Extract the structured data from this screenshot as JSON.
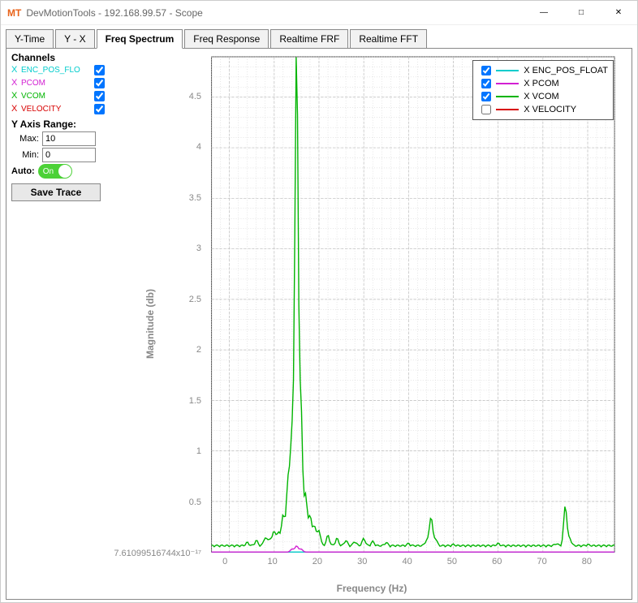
{
  "window": {
    "logo": "MT",
    "title": "DevMotionTools - 192.168.99.57 - Scope"
  },
  "tabs": [
    {
      "label": "Y-Time",
      "active": false
    },
    {
      "label": "Y - X",
      "active": false
    },
    {
      "label": "Freq Spectrum",
      "active": true
    },
    {
      "label": "Freq Response",
      "active": false
    },
    {
      "label": "Realtime FRF",
      "active": false
    },
    {
      "label": "Realtime FFT",
      "active": false
    }
  ],
  "sidebar": {
    "channels_title": "Channels",
    "channels": [
      {
        "axis": "X",
        "name": "ENC_POS_FLOAT",
        "display": "ENC_POS_FLO",
        "color": "#00cccc",
        "checked": true
      },
      {
        "axis": "X",
        "name": "PCOM",
        "display": "PCOM",
        "color": "#d21fd2",
        "checked": true
      },
      {
        "axis": "X",
        "name": "VCOM",
        "display": "VCOM",
        "color": "#00b400",
        "checked": true
      },
      {
        "axis": "X",
        "name": "VELOCITY",
        "display": "VELOCITY",
        "color": "#d80000",
        "checked": true
      }
    ],
    "range_title": "Y Axis Range:",
    "max_label": "Max:",
    "max_value": "10",
    "min_label": "Min:",
    "min_value": "0",
    "auto_label": "Auto:",
    "auto_on": "On",
    "save_label": "Save Trace"
  },
  "legend": [
    {
      "label": "X ENC_POS_FLOAT",
      "color": "#00cccc",
      "checked": true
    },
    {
      "label": "X PCOM",
      "color": "#d21fd2",
      "checked": true
    },
    {
      "label": "X VCOM",
      "color": "#00b400",
      "checked": true
    },
    {
      "label": "X VELOCITY",
      "color": "#d80000",
      "checked": false
    }
  ],
  "chart_data": {
    "type": "line",
    "xlabel": "Frequency (Hz)",
    "ylabel": "Magnitude (db)",
    "xlim": [
      -4,
      86
    ],
    "ylim": [
      0,
      4.9
    ],
    "xticks": [
      0,
      10,
      20,
      30,
      40,
      50,
      60,
      70,
      80
    ],
    "yticks_raw": [
      0,
      0.5,
      1,
      1.5,
      2,
      2.5,
      3,
      3.5,
      4,
      4.5
    ],
    "ytick_labels": [
      "7.61099516744x10⁻¹⁷",
      "0.5",
      "1",
      "1.5",
      "2",
      "2.5",
      "3",
      "3.5",
      "4",
      "4.5"
    ],
    "series": [
      {
        "name": "X VCOM",
        "color": "#00b400",
        "baseline": 0.05,
        "peaks": [
          {
            "x": 4,
            "y": 0.08
          },
          {
            "x": 6,
            "y": 0.1
          },
          {
            "x": 8,
            "y": 0.13
          },
          {
            "x": 9,
            "y": 0.12
          },
          {
            "x": 10,
            "y": 0.2
          },
          {
            "x": 11,
            "y": 0.18
          },
          {
            "x": 12,
            "y": 0.35
          },
          {
            "x": 13,
            "y": 0.55
          },
          {
            "x": 13.5,
            "y": 0.4
          },
          {
            "x": 14,
            "y": 0.9
          },
          {
            "x": 14.5,
            "y": 0.5
          },
          {
            "x": 15,
            "y": 4.78
          },
          {
            "x": 15.8,
            "y": 0.5
          },
          {
            "x": 16,
            "y": 1.05
          },
          {
            "x": 17,
            "y": 0.55
          },
          {
            "x": 18,
            "y": 0.35
          },
          {
            "x": 19,
            "y": 0.25
          },
          {
            "x": 20,
            "y": 0.2
          },
          {
            "x": 22,
            "y": 0.15
          },
          {
            "x": 24,
            "y": 0.12
          },
          {
            "x": 26,
            "y": 0.1
          },
          {
            "x": 28,
            "y": 0.09
          },
          {
            "x": 30,
            "y": 0.12
          },
          {
            "x": 32,
            "y": 0.09
          },
          {
            "x": 35,
            "y": 0.08
          },
          {
            "x": 40,
            "y": 0.07
          },
          {
            "x": 44,
            "y": 0.1
          },
          {
            "x": 45,
            "y": 0.34
          },
          {
            "x": 46,
            "y": 0.12
          },
          {
            "x": 50,
            "y": 0.06
          },
          {
            "x": 55,
            "y": 0.05
          },
          {
            "x": 60,
            "y": 0.07
          },
          {
            "x": 65,
            "y": 0.05
          },
          {
            "x": 70,
            "y": 0.05
          },
          {
            "x": 73,
            "y": 0.07
          },
          {
            "x": 75,
            "y": 0.45
          },
          {
            "x": 76,
            "y": 0.12
          },
          {
            "x": 80,
            "y": 0.06
          },
          {
            "x": 84,
            "y": 0.05
          }
        ]
      },
      {
        "name": "X PCOM",
        "color": "#d21fd2",
        "baseline": 0.0,
        "peaks": [
          {
            "x": 14,
            "y": 0.03
          },
          {
            "x": 15,
            "y": 0.06
          },
          {
            "x": 16,
            "y": 0.03
          }
        ]
      },
      {
        "name": "X ENC_POS_FLOAT",
        "color": "#00cccc",
        "baseline": 0.0,
        "peaks": []
      }
    ]
  }
}
